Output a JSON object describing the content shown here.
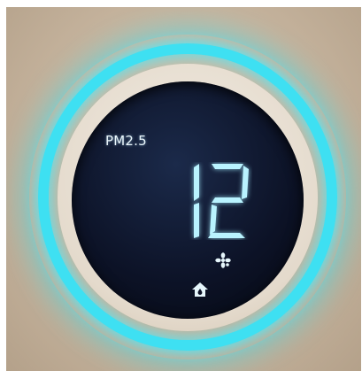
{
  "display": {
    "label": "PM2.5",
    "reading": "12"
  },
  "icons": {
    "fan": "fan-icon",
    "home": "home-icon"
  },
  "colors": {
    "ring": "#3ee0f2",
    "screen": "#0c1226",
    "segments": "#b9f3ff",
    "housing": "#c7b59f"
  }
}
